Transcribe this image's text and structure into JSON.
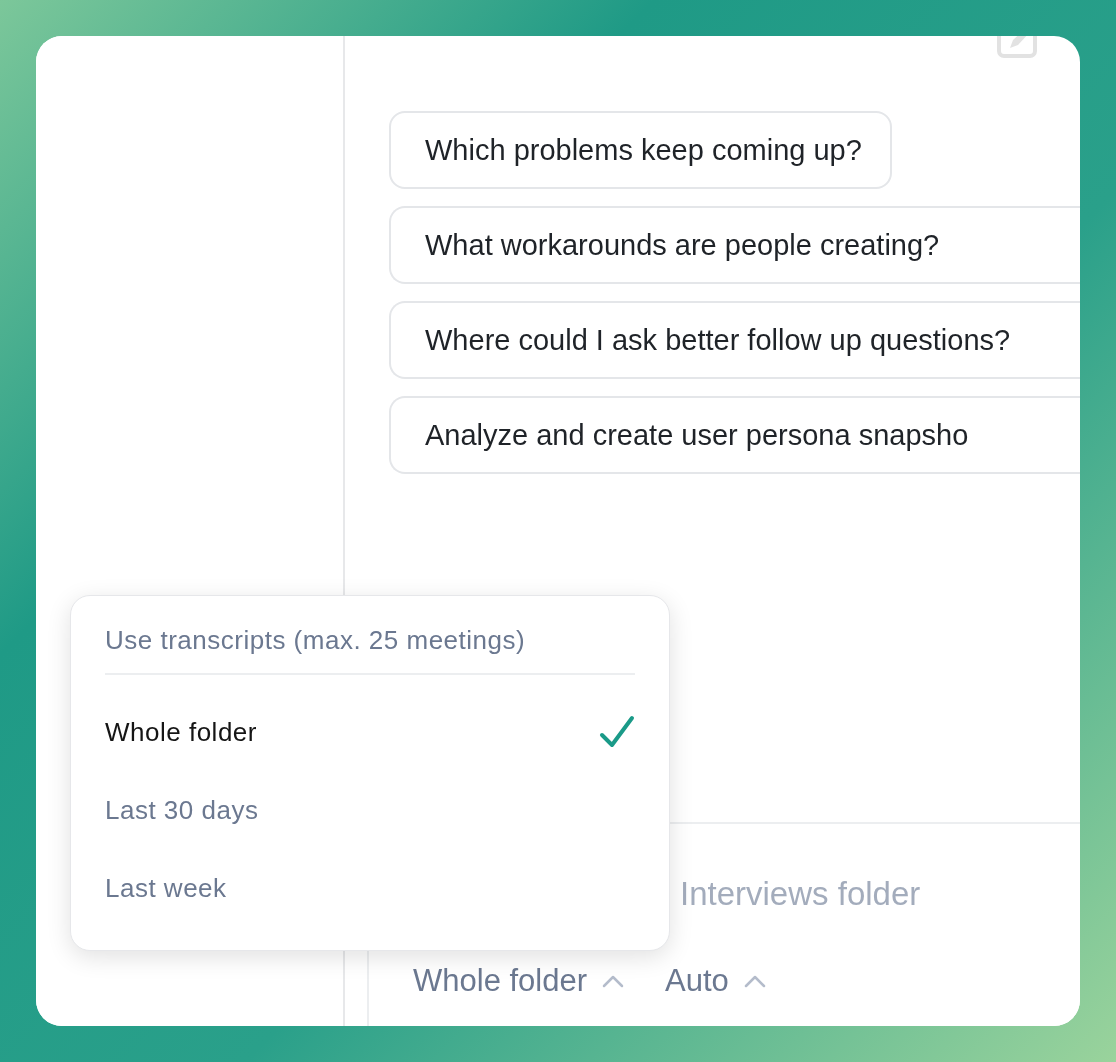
{
  "suggestions": [
    {
      "text": "Which problems keep coming up?",
      "clipped": false
    },
    {
      "text": "What workarounds are people creating?",
      "clipped": true
    },
    {
      "text": "Where could I ask better follow up questions?",
      "clipped": true
    },
    {
      "text": "Analyze and create user persona snapsho",
      "clipped": true
    }
  ],
  "composer": {
    "placeholder": "Interviews folder",
    "selectors": [
      {
        "label": "Whole folder"
      },
      {
        "label": "Auto"
      }
    ]
  },
  "menu": {
    "title": "Use transcripts (max. 25 meetings)",
    "options": [
      {
        "label": "Whole folder",
        "selected": true
      },
      {
        "label": "Last 30 days",
        "selected": false
      },
      {
        "label": "Last week",
        "selected": false
      }
    ]
  }
}
